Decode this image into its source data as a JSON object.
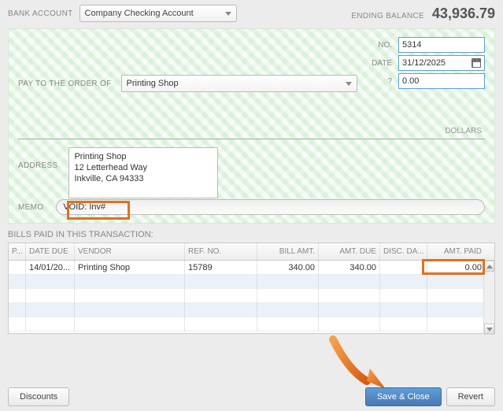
{
  "header": {
    "bank_account_label": "BANK ACCOUNT",
    "bank_account_value": "Company Checking Account",
    "ending_balance_label": "ENDING BALANCE",
    "ending_balance_value": "43,936.79"
  },
  "check": {
    "no_label": "NO.",
    "no_value": "5314",
    "date_label": "DATE",
    "date_value": "31/12/2025",
    "amount_label": "?",
    "amount_value": "0.00",
    "payee_label": "PAY TO THE ORDER OF",
    "payee_value": "Printing Shop",
    "dollars_label": "DOLLARS",
    "address_label": "ADDRESS",
    "address_lines": "Printing Shop\n12 Letterhead Way\nInkville, CA 94333",
    "memo_label": "MEMO",
    "memo_value": "VOID: Inv#"
  },
  "bills": {
    "title": "BILLS PAID IN THIS TRANSACTION:",
    "columns": {
      "p": "P...",
      "date_due": "DATE DUE",
      "vendor": "VENDOR",
      "ref_no": "REF. NO.",
      "bill_amt": "BILL AMT.",
      "amt_due": "AMT. DUE",
      "disc_date": "DISC. DA...",
      "amt_paid": "AMT. PAID"
    },
    "rows": [
      {
        "date_due": "14/01/20...",
        "vendor": "Printing Shop",
        "ref_no": "15789",
        "bill_amt": "340.00",
        "amt_due": "340.00",
        "disc_date": "",
        "amt_paid": "0.00"
      }
    ]
  },
  "footer": {
    "discounts_label": "Discounts",
    "save_close_label": "Save & Close",
    "revert_label": "Revert"
  }
}
